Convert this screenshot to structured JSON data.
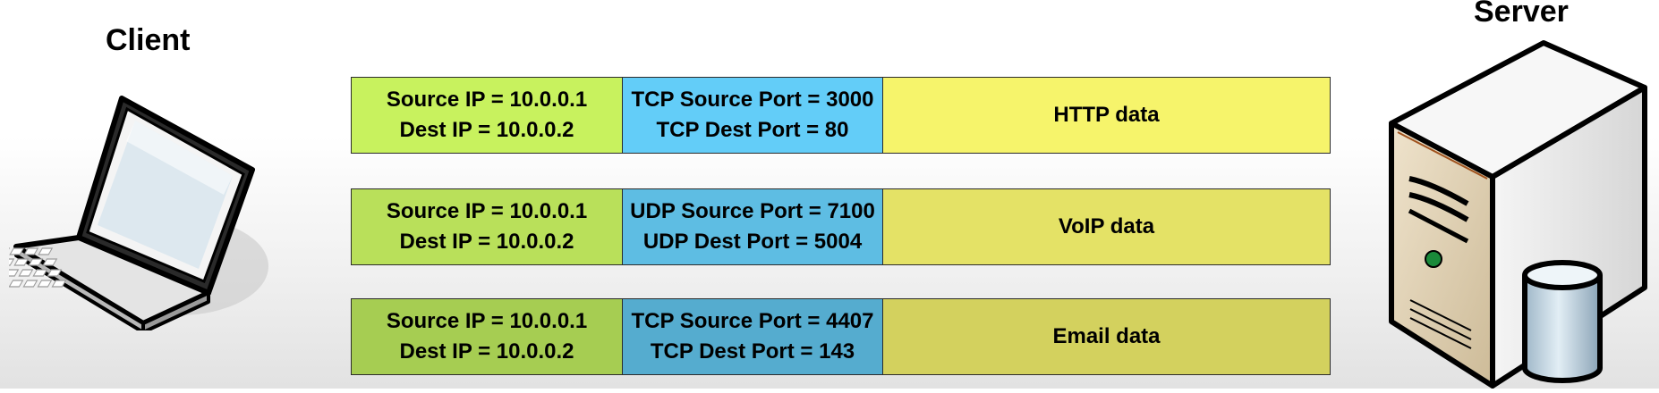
{
  "labels": {
    "client": "Client",
    "server": "Server"
  },
  "icons": {
    "client": "laptop-icon",
    "server": "server-icon"
  },
  "packets": [
    {
      "ip_line1": "Source IP = 10.0.0.1",
      "ip_line2": "Dest IP = 10.0.0.2",
      "port_line1": "TCP Source Port = 3000",
      "port_line2": "TCP Dest Port = 80",
      "payload": "HTTP data"
    },
    {
      "ip_line1": "Source IP = 10.0.0.1",
      "ip_line2": "Dest IP = 10.0.0.2",
      "port_line1": "UDP Source Port = 7100",
      "port_line2": "UDP Dest Port = 5004",
      "payload": "VoIP data"
    },
    {
      "ip_line1": "Source IP = 10.0.0.1",
      "ip_line2": "Dest IP = 10.0.0.2",
      "port_line1": "TCP Source Port = 4407",
      "port_line2": "TCP Dest Port = 143",
      "payload": "Email data"
    }
  ],
  "colors": {
    "ip_cell": [
      "#c8f25e",
      "#b9e05a",
      "#a6cd52"
    ],
    "port_cell": [
      "#63cdf8",
      "#5ebde3",
      "#55accf"
    ],
    "payload_cell": [
      "#f6f46b",
      "#e4e266",
      "#d3d15e"
    ]
  }
}
